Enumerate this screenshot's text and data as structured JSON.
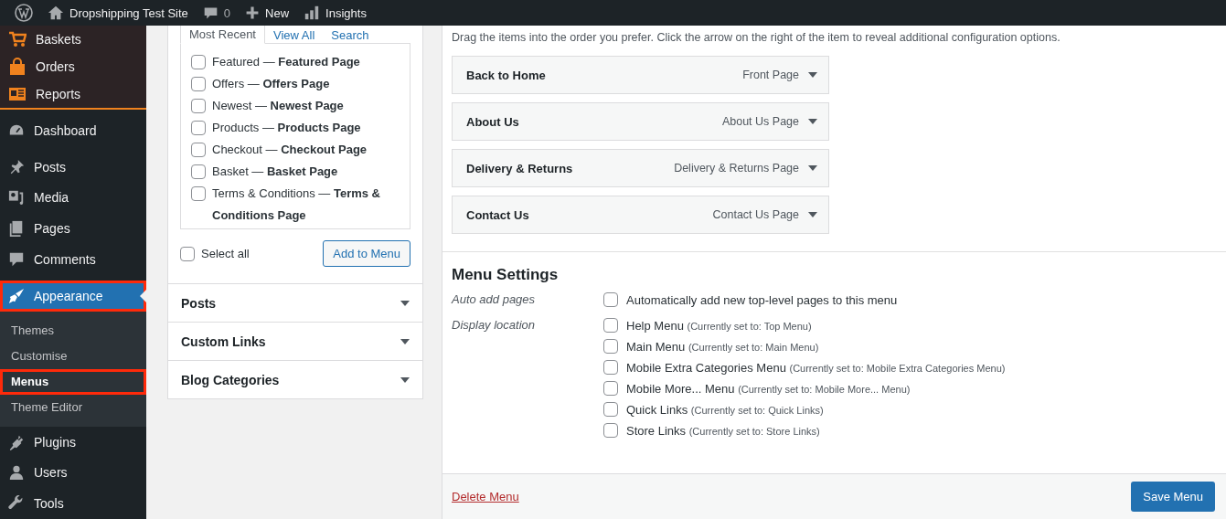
{
  "admin_bar": {
    "site_title": "Dropshipping Test Site",
    "comments_count": "0",
    "new_label": "New",
    "insights_label": "Insights"
  },
  "sidebar": {
    "store_items": [
      {
        "label": "Baskets",
        "selected": false
      },
      {
        "label": "Orders",
        "selected": false
      },
      {
        "label": "Reports",
        "selected": false
      }
    ],
    "items": [
      {
        "label": "Dashboard",
        "selected": false,
        "highlighted": false
      },
      {
        "label": "Posts",
        "selected": false,
        "highlighted": false
      },
      {
        "label": "Media",
        "selected": false,
        "highlighted": false
      },
      {
        "label": "Pages",
        "selected": false,
        "highlighted": false
      },
      {
        "label": "Comments",
        "selected": false,
        "highlighted": false
      },
      {
        "label": "Appearance",
        "selected": true,
        "highlighted": true,
        "children": [
          {
            "label": "Themes",
            "selected": false,
            "highlighted": false
          },
          {
            "label": "Customise",
            "selected": false,
            "highlighted": false
          },
          {
            "label": "Menus",
            "selected": true,
            "highlighted": true
          },
          {
            "label": "Theme Editor",
            "selected": false,
            "highlighted": false
          }
        ]
      },
      {
        "label": "Plugins",
        "selected": false,
        "highlighted": false
      },
      {
        "label": "Users",
        "selected": false,
        "highlighted": false
      },
      {
        "label": "Tools",
        "selected": false,
        "highlighted": false
      }
    ]
  },
  "pages_box": {
    "tabs": [
      {
        "label": "Most Recent",
        "selected": true
      },
      {
        "label": "View All",
        "selected": false
      },
      {
        "label": "Search",
        "selected": false
      }
    ],
    "pages": [
      {
        "label": "Featured — **Featured Page**",
        "checked": false
      },
      {
        "label": "Offers — **Offers Page**",
        "checked": false
      },
      {
        "label": "Newest — **Newest Page**",
        "checked": false
      },
      {
        "label": "Products — **Products Page**",
        "checked": false
      },
      {
        "label": "Checkout — **Checkout Page**",
        "checked": false
      },
      {
        "label": "Basket — **Basket Page**",
        "checked": false
      },
      {
        "label": "Terms & Conditions — **Terms & Conditions Page**",
        "checked": false
      }
    ],
    "select_all": {
      "label": "Select all",
      "checked": false
    },
    "add_button": "Add to Menu"
  },
  "accordion": [
    {
      "title": "Posts"
    },
    {
      "title": "Custom Links"
    },
    {
      "title": "Blog Categories"
    }
  ],
  "menu_structure": {
    "instructions": "Drag the items into the order you prefer. Click the arrow on the right of the item to reveal additional configuration options.",
    "items": [
      {
        "title": "Back to Home",
        "type": "Front Page"
      },
      {
        "title": "About Us",
        "type": "About Us Page"
      },
      {
        "title": "Delivery & Returns",
        "type": "Delivery & Returns Page"
      },
      {
        "title": "Contact Us",
        "type": "Contact Us Page"
      }
    ]
  },
  "menu_settings": {
    "title": "Menu Settings",
    "auto_add": {
      "label": "Auto add pages",
      "option": "Automatically add new top-level pages to this menu",
      "checked": false
    },
    "display_location": {
      "label": "Display location",
      "options": [
        {
          "name": "Help Menu",
          "note": "(Currently set to: Top Menu)",
          "checked": false
        },
        {
          "name": "Main Menu",
          "note": "(Currently set to: Main Menu)",
          "checked": false
        },
        {
          "name": "Mobile Extra Categories Menu",
          "note": "(Currently set to: Mobile Extra Categories Menu)",
          "checked": false
        },
        {
          "name": "Mobile More... Menu",
          "note": "(Currently set to: Mobile More... Menu)",
          "checked": false
        },
        {
          "name": "Quick Links",
          "note": "(Currently set to: Quick Links)",
          "checked": false
        },
        {
          "name": "Store Links",
          "note": "(Currently set to: Store Links)",
          "checked": false
        }
      ]
    }
  },
  "footer": {
    "delete_link": "Delete Menu",
    "save_button": "Save Menu"
  }
}
